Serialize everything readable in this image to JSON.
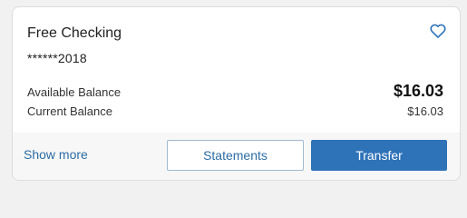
{
  "account": {
    "name": "Free Checking",
    "masked_number": "******2018",
    "favorite_icon": "heart-outline-icon"
  },
  "balances": {
    "available_label": "Available Balance",
    "available_amount": "$16.03",
    "current_label": "Current Balance",
    "current_amount": "$16.03"
  },
  "actions": {
    "show_more_label": "Show more",
    "statements_label": "Statements",
    "transfer_label": "Transfer"
  },
  "colors": {
    "accent": "#2e72b8",
    "link": "#2d6ca5",
    "card_background": "#ffffff",
    "footer_background": "#f7f7f7",
    "page_background": "#f1f1f1"
  }
}
